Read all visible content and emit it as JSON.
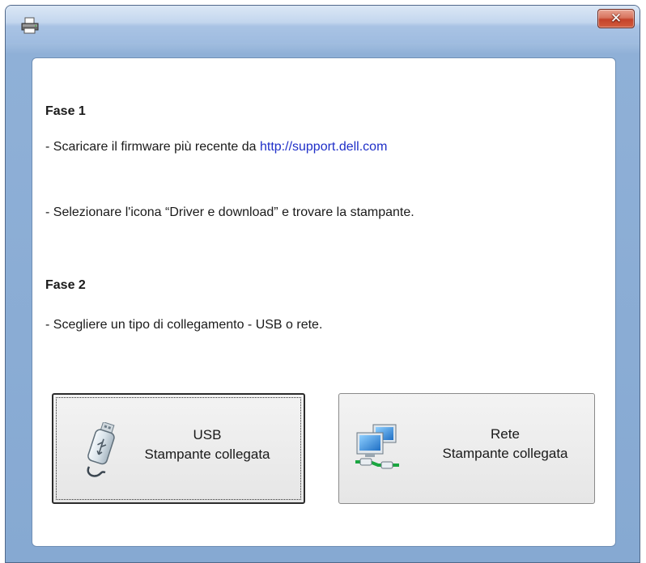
{
  "window": {
    "title": "",
    "close_glyph": "✕",
    "app_icon": "printer-icon"
  },
  "content": {
    "step1_heading": "Fase 1",
    "step1_line1_prefix": "- Scaricare il firmware più recente da ",
    "step1_link": "http://support.dell.com",
    "step1_line2": "- Selezionare l'icona “Driver e download” e trovare la stampante.",
    "step2_heading": "Fase 2",
    "step2_line1": "- Scegliere un tipo di collegamento - USB o rete."
  },
  "buttons": {
    "usb": {
      "line1": "USB",
      "line2": "Stampante collegata",
      "icon": "usb-drive-icon",
      "focused": true
    },
    "rete": {
      "line1": "Rete",
      "line2": "Stampante collegata",
      "icon": "network-computers-icon",
      "focused": false
    }
  },
  "colors": {
    "link": "#1f2fc8",
    "close_button": "#c4432a",
    "frame": "#9fbce0"
  }
}
